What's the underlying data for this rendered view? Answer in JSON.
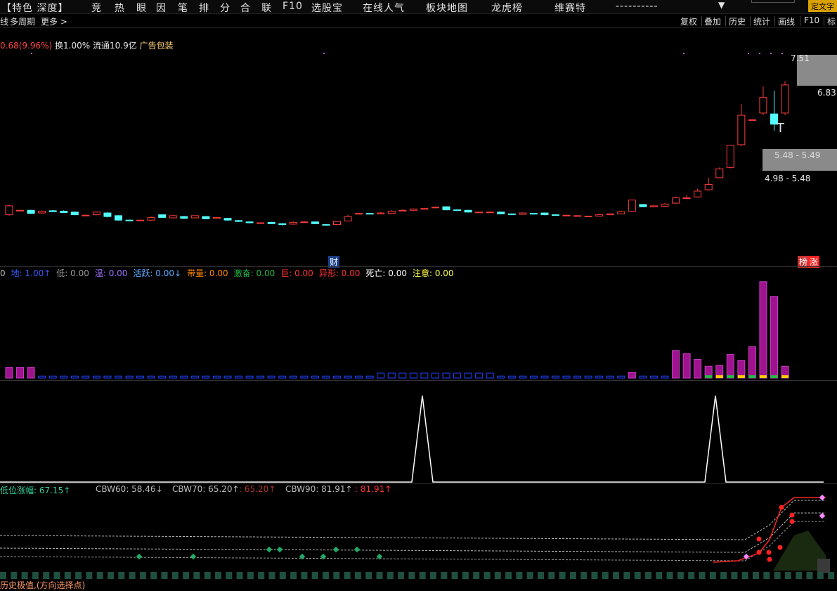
{
  "menu": {
    "items": [
      "【特色 深度】",
      "竞",
      "热",
      "眼",
      "因",
      "笔",
      "排",
      "分",
      "合",
      "联",
      "F10",
      "选股宝",
      "在线人气",
      "板块地图",
      "龙虎榜",
      "维赛特",
      "----------"
    ],
    "dropdown_icon": "triangle-down",
    "special_label": "定文字"
  },
  "toolbar": {
    "left_cut": "线",
    "multi_period": "多周期",
    "more": "更多",
    "buttons": [
      "复权",
      "叠加",
      "历史",
      "统计",
      "画线",
      "F10",
      "标"
    ]
  },
  "info": {
    "change": "0.68(9.96%)",
    "turnover": "换1.00%",
    "float": "流通10.9亿",
    "industry": "广告包装"
  },
  "price_labels": {
    "high": "7.51",
    "last": "6.83",
    "zone1": "5.48 - 5.49",
    "zone2": "4.98 - 5.48",
    "mark_t": "T",
    "cai": "财",
    "bang": "榜",
    "zhang": "涨"
  },
  "indicators": [
    {
      "name": "地",
      "value": "1.00",
      "arrow": "↑",
      "color": "#3a5cff"
    },
    {
      "name": "低",
      "value": "0.00",
      "arrow": "",
      "color": "#9a9a9a"
    },
    {
      "name": "温",
      "value": "0.00",
      "arrow": "",
      "color": "#a070ff"
    },
    {
      "name": "活跃",
      "value": "0.00",
      "arrow": "↓",
      "color": "#5aaaff"
    },
    {
      "name": "带量",
      "value": "0.00",
      "arrow": "",
      "color": "#ff8800"
    },
    {
      "name": "激奋",
      "value": "0.00",
      "arrow": "",
      "color": "#22bb44"
    },
    {
      "name": "巨",
      "value": "0.00",
      "arrow": "",
      "color": "#ff3333"
    },
    {
      "name": "异形",
      "value": "0.00",
      "arrow": "",
      "color": "#ff3333"
    },
    {
      "name": "死亡",
      "value": "0.00",
      "arrow": "",
      "color": "#ffffff"
    },
    {
      "name": "注意",
      "value": "0.00",
      "arrow": "",
      "color": "#ffff44"
    }
  ],
  "ind_left_cut": "0",
  "cbw": [
    {
      "name": "低位涨幅",
      "value": "67.15",
      "arrow": "↑",
      "color": "#33cc99"
    },
    {
      "name": "CBW60",
      "value": "58.46",
      "arrow": "↓",
      "color": "#bbbbbb"
    },
    {
      "name": "CBW70",
      "value": "65.20",
      "arrow": "↑",
      "color": "#bbbbbb"
    },
    {
      "name": "",
      "value": "65.20",
      "arrow": "↑",
      "color": "#aa3333"
    },
    {
      "name": "CBW90",
      "value": "81.91",
      "arrow": "↑",
      "color": "#bbbbbb"
    },
    {
      "name": "",
      "value": "81.91",
      "arrow": "↑",
      "color": "#ff3333"
    }
  ],
  "bottom_note": "历史极值,(方向选择点)",
  "colors": {
    "up": "#ff3b3b",
    "down": "#54ffff",
    "vol_main": "#a0138e",
    "line": "#ffffff"
  },
  "chart_data": {
    "type": "candlestick",
    "ylim": [
      3.0,
      7.6
    ],
    "candles": [
      [
        3.92,
        4.12,
        4.15,
        3.9
      ],
      [
        4.02,
        4.02,
        4.02,
        4.02
      ],
      [
        4.02,
        3.95,
        4.03,
        3.94
      ],
      [
        3.96,
        4.0,
        4.02,
        3.95
      ],
      [
        4.01,
        3.99,
        4.03,
        3.98
      ],
      [
        4.0,
        3.97,
        4.02,
        3.96
      ],
      [
        3.98,
        3.92,
        3.99,
        3.91
      ],
      [
        3.91,
        3.91,
        3.92,
        3.9
      ],
      [
        3.92,
        3.98,
        3.99,
        3.91
      ],
      [
        3.96,
        3.88,
        3.98,
        3.86
      ],
      [
        3.9,
        3.8,
        3.91,
        3.79
      ],
      [
        3.8,
        3.79,
        3.81,
        3.78
      ],
      [
        3.79,
        3.8,
        3.81,
        3.78
      ],
      [
        3.8,
        3.86,
        3.88,
        3.79
      ],
      [
        3.92,
        3.86,
        3.93,
        3.85
      ],
      [
        3.85,
        3.9,
        3.92,
        3.84
      ],
      [
        3.88,
        3.84,
        3.89,
        3.83
      ],
      [
        3.85,
        3.9,
        3.91,
        3.84
      ],
      [
        3.88,
        3.83,
        3.89,
        3.82
      ],
      [
        3.84,
        3.86,
        3.87,
        3.83
      ],
      [
        3.84,
        3.8,
        3.85,
        3.79
      ],
      [
        3.79,
        3.77,
        3.8,
        3.76
      ],
      [
        3.76,
        3.74,
        3.77,
        3.73
      ],
      [
        3.74,
        3.74,
        3.75,
        3.73
      ],
      [
        3.75,
        3.72,
        3.76,
        3.71
      ],
      [
        3.72,
        3.7,
        3.73,
        3.68
      ],
      [
        3.71,
        3.75,
        3.77,
        3.7
      ],
      [
        3.75,
        3.76,
        3.78,
        3.74
      ],
      [
        3.76,
        3.72,
        3.77,
        3.71
      ],
      [
        3.7,
        3.69,
        3.71,
        3.68
      ],
      [
        3.7,
        3.77,
        3.78,
        3.69
      ],
      [
        3.78,
        3.88,
        3.92,
        3.77
      ],
      [
        3.95,
        3.95,
        3.96,
        3.94
      ],
      [
        3.95,
        3.94,
        3.96,
        3.93
      ],
      [
        3.94,
        3.96,
        3.98,
        3.93
      ],
      [
        3.95,
        4.0,
        4.02,
        3.94
      ],
      [
        4.02,
        4.02,
        4.04,
        4.01
      ],
      [
        4.02,
        4.05,
        4.06,
        4.01
      ],
      [
        4.05,
        4.06,
        4.07,
        4.04
      ],
      [
        4.08,
        4.09,
        4.1,
        4.07
      ],
      [
        4.1,
        4.03,
        4.11,
        4.02
      ],
      [
        4.03,
        4.02,
        4.04,
        4.01
      ],
      [
        4.02,
        3.98,
        4.03,
        3.97
      ],
      [
        3.98,
        3.98,
        3.99,
        3.97
      ],
      [
        3.98,
        3.98,
        3.99,
        3.97
      ],
      [
        3.98,
        3.94,
        3.99,
        3.93
      ],
      [
        3.94,
        3.93,
        3.95,
        3.92
      ],
      [
        3.93,
        3.96,
        3.97,
        3.92
      ],
      [
        3.95,
        3.94,
        3.96,
        3.93
      ],
      [
        3.96,
        3.92,
        3.97,
        3.91
      ],
      [
        3.92,
        3.91,
        3.93,
        3.9
      ],
      [
        3.91,
        3.91,
        3.92,
        3.9
      ],
      [
        3.9,
        3.9,
        3.91,
        3.89
      ],
      [
        3.89,
        3.89,
        3.9,
        3.88
      ],
      [
        3.89,
        3.92,
        3.93,
        3.88
      ],
      [
        3.92,
        3.94,
        3.95,
        3.91
      ],
      [
        3.94,
        3.99,
        4.01,
        3.93
      ],
      [
        4.0,
        4.25,
        4.26,
        3.99
      ],
      [
        4.15,
        4.1,
        4.16,
        4.09
      ],
      [
        4.1,
        4.12,
        4.13,
        4.09
      ],
      [
        4.11,
        4.16,
        4.18,
        4.1
      ],
      [
        4.18,
        4.3,
        4.32,
        4.17
      ],
      [
        4.3,
        4.3,
        4.36,
        4.28
      ],
      [
        4.32,
        4.45,
        4.5,
        4.31
      ],
      [
        4.48,
        4.6,
        4.75,
        4.46
      ],
      [
        4.75,
        4.95,
        4.98,
        4.74
      ],
      [
        4.98,
        5.48,
        5.49,
        4.96
      ],
      [
        5.49,
        6.15,
        6.4,
        5.46
      ],
      [
        6.05,
        6.05,
        6.05,
        6.05
      ],
      [
        6.2,
        6.55,
        6.8,
        6.15
      ],
      [
        6.18,
        5.95,
        6.7,
        5.8
      ],
      [
        6.2,
        6.83,
        6.92,
        6.15
      ]
    ]
  }
}
